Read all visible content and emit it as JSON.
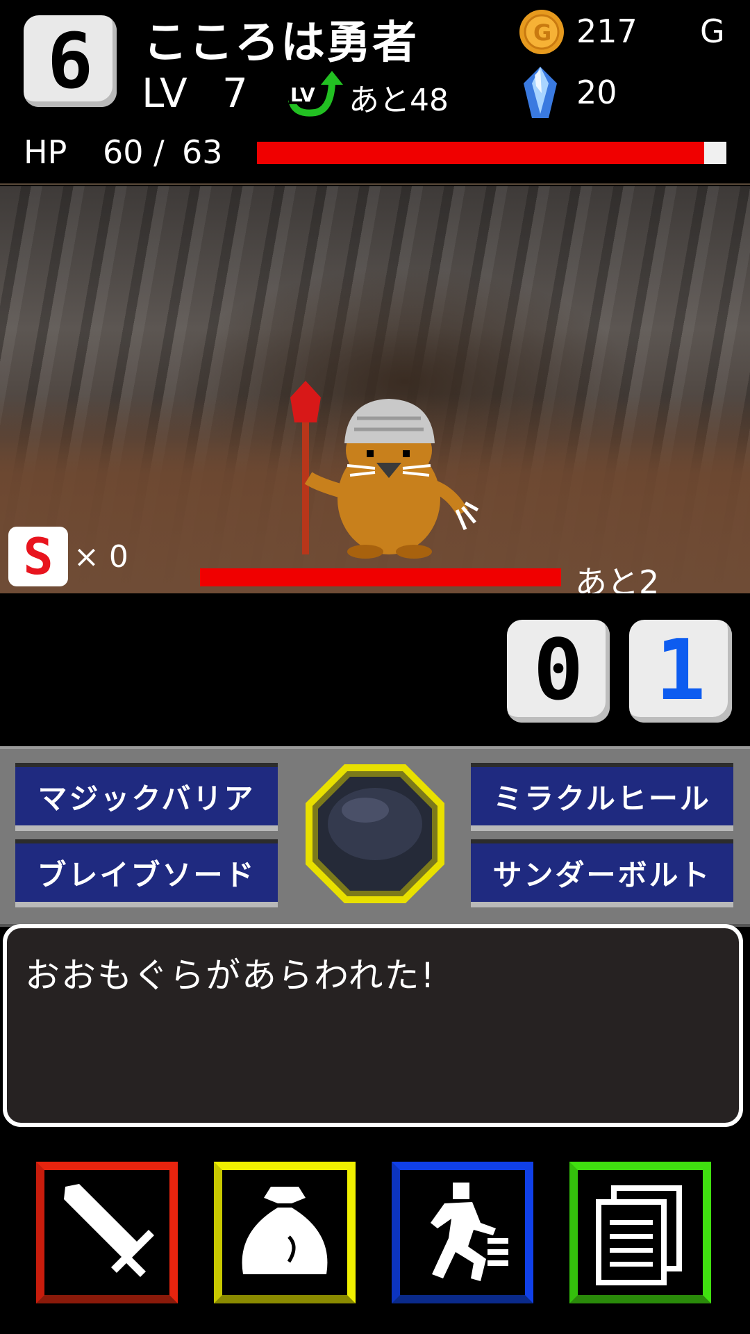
{
  "header": {
    "floor": "6",
    "player_name": "こころは勇者",
    "level_label": "LV",
    "level_value": "7",
    "next_level_text": "あと48",
    "gold_value": "217",
    "gold_unit": "G",
    "gem_value": "20",
    "hp_label": "HP",
    "hp_current": "60 /",
    "hp_max": "63",
    "hp_fraction": 0.952
  },
  "battle": {
    "s_count": "× 0",
    "enemy_remaining_text": "あと2",
    "enemy_hp_fraction": 1.0
  },
  "combo": {
    "digit_1": "0",
    "digit_2": "1"
  },
  "skills": {
    "top_left": "マジックバリア",
    "top_right": "ミラクルヒール",
    "bottom_left": "ブレイブソード",
    "bottom_right": "サンダーボルト"
  },
  "message": {
    "text": "おおもぐらがあらわれた!"
  },
  "commands": {
    "attack_icon": "sword-icon",
    "item_icon": "bag-icon",
    "flee_icon": "run-icon",
    "menu_icon": "documents-icon"
  },
  "colors": {
    "hp_bar": "#f00000",
    "attack": "#e8240e",
    "item": "#f0f000",
    "flee": "#1040e8",
    "menu": "#40e010",
    "skill_button": "#1f2a80"
  }
}
